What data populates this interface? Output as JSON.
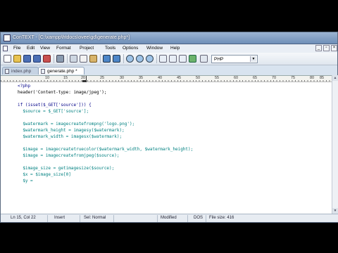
{
  "window": {
    "title": "ConTEXT - [C:\\xampp\\htdocs\\ovee\\gd\\generate.php*]"
  },
  "menu": [
    "File",
    "Edit",
    "View",
    "Format",
    "Project",
    "Tools",
    "Options",
    "Window",
    "Help"
  ],
  "toolbar": {
    "language": "PHP"
  },
  "tabs": [
    {
      "label": "index.php",
      "active": false
    },
    {
      "label": "generate.php *",
      "active": true
    }
  ],
  "ruler": {
    "labels": [
      "10",
      "15",
      "20",
      "25",
      "30",
      "35",
      "40",
      "45",
      "50",
      "55",
      "60",
      "65",
      "70",
      "75",
      "80",
      "85",
      "90",
      "95"
    ]
  },
  "code_lines": [
    "<?php",
    "header('Content-type: image/jpeg');",
    "",
    "if (isset($_GET['source'])) {",
    "  $source = $_GET['source'];",
    "",
    "  $watermark = imagecreatefrompng('logo.png');",
    "  $watermark_height = imagesy($watermark);",
    "  $watermark_width = imagesx($watermark);",
    "",
    "  $image = imagecreatetruecolor($watermark_width, $watermark_height);",
    "  $image = imagecreatefromjpeg($source);",
    "",
    "  $image_size = getimagesize($source);",
    "  $x = $image_size[0]",
    "  $y ="
  ],
  "status": {
    "position": "Ln 15, Col 22",
    "insert": "Insert",
    "sel": "Sel: Normal",
    "modified": "Modified",
    "format": "DOS",
    "filesize": "File size: 416"
  },
  "colors": {
    "keyword": "#000088",
    "variable": "#008080",
    "window_bg": "#d8e3ef"
  }
}
